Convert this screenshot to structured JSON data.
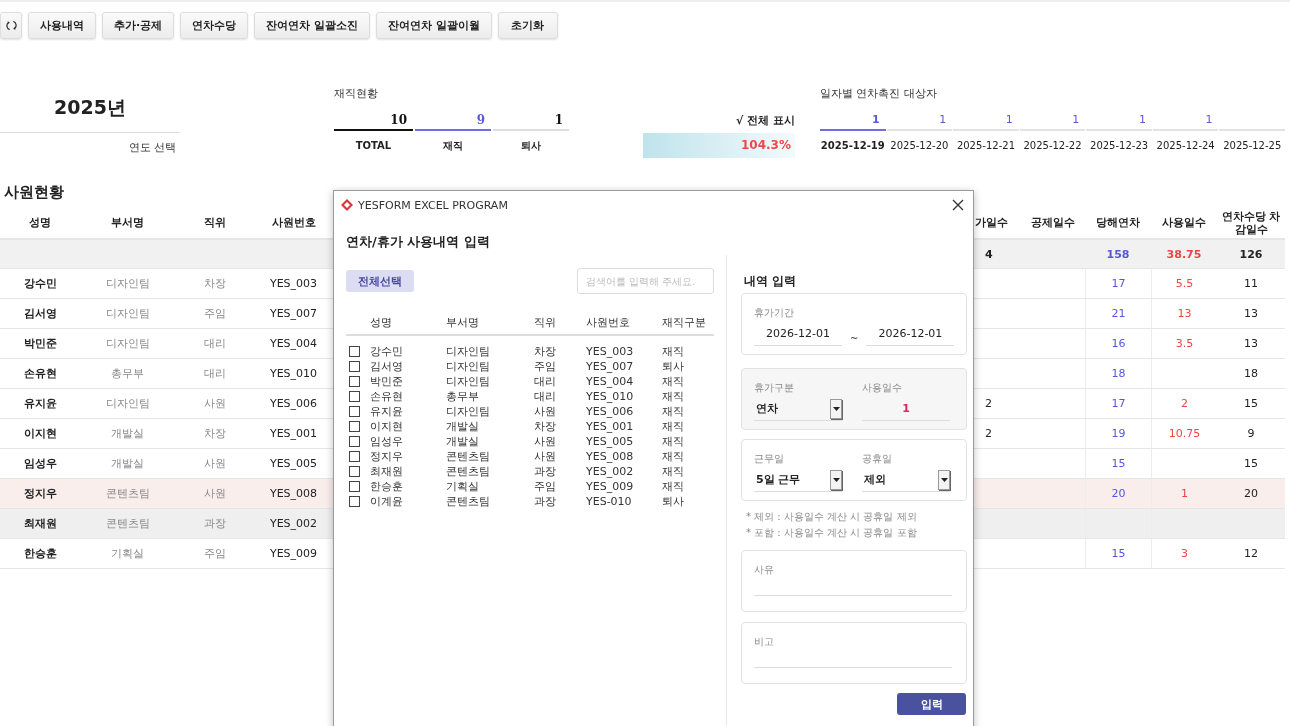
{
  "toolbar": {
    "buttons": [
      {
        "kind": "refresh"
      },
      {
        "kind": "text",
        "label": "사용내역"
      },
      {
        "kind": "text",
        "label": "추가·공제"
      },
      {
        "kind": "text",
        "label": "연차수당"
      },
      {
        "kind": "text",
        "label": "잔여연차 일괄소진"
      },
      {
        "kind": "text",
        "label": "잔여연차 일괄이월"
      },
      {
        "kind": "text",
        "label": "초기화"
      }
    ]
  },
  "year": {
    "value": "2025년",
    "label": "연도 선택"
  },
  "employment": {
    "title": "재직현황",
    "stats": [
      {
        "kind": "total",
        "value": "10",
        "label": "TOTAL"
      },
      {
        "kind": "active",
        "value": "9",
        "label": "재직"
      },
      {
        "kind": "resigned",
        "value": "1",
        "label": "퇴사"
      }
    ]
  },
  "show_all": {
    "label": "√ 전체 표시",
    "reading": "104.3%",
    "level": 1
  },
  "promotion": {
    "title": "일자별 연차촉진 대상자",
    "dates": [
      {
        "count": "1",
        "date": "2025-12-19",
        "selected": true
      },
      {
        "count": "1",
        "date": "2025-12-20",
        "selected": false
      },
      {
        "count": "1",
        "date": "2025-12-21",
        "selected": false
      },
      {
        "count": "1",
        "date": "2025-12-22",
        "selected": false
      },
      {
        "count": "1",
        "date": "2025-12-23",
        "selected": false
      },
      {
        "count": "1",
        "date": "2025-12-24",
        "selected": false
      },
      {
        "date": "2025-12-25",
        "selected": false
      }
    ]
  },
  "employees": {
    "title": "사원현황",
    "columns": [
      "성명",
      "부서명",
      "직위",
      "사원번호"
    ],
    "right_columns": [
      "가일수",
      "공제일수",
      "당해연차",
      "사용일수",
      "연차수당 차감일수"
    ],
    "total": {
      "added": "4",
      "annual": "158",
      "used": "38.75",
      "allowance_deduction": "126"
    },
    "rows": [
      {
        "name": "강수민",
        "dept": "디자인팀",
        "position": "차장",
        "id": "YES_003",
        "annual": "17",
        "used": "5.5",
        "allowance_deduction": "11",
        "selected": false,
        "hovered": false
      },
      {
        "name": "김서영",
        "dept": "디자인팀",
        "position": "주임",
        "id": "YES_007",
        "annual": "21",
        "used": "13",
        "allowance_deduction": "13",
        "selected": false,
        "hovered": false
      },
      {
        "name": "박민준",
        "dept": "디자인팀",
        "position": "대리",
        "id": "YES_004",
        "annual": "16",
        "used": "3.5",
        "allowance_deduction": "13",
        "selected": false,
        "hovered": false
      },
      {
        "name": "손유현",
        "dept": "총무부",
        "position": "대리",
        "id": "YES_010",
        "annual": "18",
        "allowance_deduction": "18",
        "selected": false,
        "hovered": false
      },
      {
        "name": "유지윤",
        "dept": "디자인팀",
        "position": "사원",
        "id": "YES_006",
        "added": "2",
        "annual": "17",
        "used": "2",
        "allowance_deduction": "15",
        "selected": false,
        "hovered": false
      },
      {
        "name": "이지현",
        "dept": "개발실",
        "position": "차장",
        "id": "YES_001",
        "added": "2",
        "annual": "19",
        "used": "10.75",
        "allowance_deduction": "9",
        "selected": false,
        "hovered": false
      },
      {
        "name": "임성우",
        "dept": "개발실",
        "position": "사원",
        "id": "YES_005",
        "annual": "15",
        "allowance_deduction": "15",
        "selected": false,
        "hovered": false
      },
      {
        "name": "정지우",
        "dept": "콘텐츠팀",
        "position": "사원",
        "id": "YES_008",
        "annual": "20",
        "used": "1",
        "allowance_deduction": "20",
        "selected": false,
        "hovered": true
      },
      {
        "name": "최재원",
        "dept": "콘텐츠팀",
        "position": "과장",
        "id": "YES_002",
        "selected": true,
        "hovered": false
      },
      {
        "name": "한승훈",
        "dept": "기획실",
        "position": "주임",
        "id": "YES_009",
        "annual": "15",
        "used": "3",
        "allowance_deduction": "12",
        "selected": false,
        "hovered": false
      }
    ]
  },
  "dialog": {
    "app_title": "YESFORM EXCEL PROGRAM",
    "heading": "연차/휴가 사용내역 입력",
    "select_all": "전체선택",
    "search": {
      "placeholder": "검색어를 입력해 주세요."
    },
    "columns": [
      "성명",
      "부서명",
      "직위",
      "사원번호",
      "재직구분"
    ],
    "rows": [
      {
        "cells": [
          "강수민",
          "디자인팀",
          "차장",
          "YES_003",
          "재직"
        ],
        "checked": false
      },
      {
        "cells": [
          "김서영",
          "디자인팀",
          "주임",
          "YES_007",
          "퇴사"
        ],
        "checked": false
      },
      {
        "cells": [
          "박민준",
          "디자인팀",
          "대리",
          "YES_004",
          "재직"
        ],
        "checked": false
      },
      {
        "cells": [
          "손유현",
          "총무부",
          "대리",
          "YES_010",
          "재직"
        ],
        "checked": false
      },
      {
        "cells": [
          "유지윤",
          "디자인팀",
          "사원",
          "YES_006",
          "재직"
        ],
        "checked": false
      },
      {
        "cells": [
          "이지현",
          "개발실",
          "차장",
          "YES_001",
          "재직"
        ],
        "checked": false
      },
      {
        "cells": [
          "임성우",
          "개발실",
          "사원",
          "YES_005",
          "재직"
        ],
        "checked": false
      },
      {
        "cells": [
          "정지우",
          "콘텐츠팀",
          "사원",
          "YES_008",
          "재직"
        ],
        "checked": false
      },
      {
        "cells": [
          "최재원",
          "콘텐츠팀",
          "과장",
          "YES_002",
          "재직"
        ],
        "checked": false
      },
      {
        "cells": [
          "한승훈",
          "기획실",
          "주임",
          "YES_009",
          "재직"
        ],
        "checked": false
      },
      {
        "cells": [
          "이계윤",
          "콘텐츠팀",
          "과장",
          "YES-010",
          "퇴사"
        ],
        "checked": false
      }
    ],
    "form": {
      "title": "내역 입력",
      "period": {
        "label": "휴가기간",
        "from": "2026-12-01",
        "separator": "~",
        "to": "2026-12-01"
      },
      "leave_type": {
        "label": "휴가구분",
        "value": "연차"
      },
      "days": {
        "label": "사용일수",
        "value": "1"
      },
      "workdays": {
        "label": "근무일",
        "value": "5일 근무"
      },
      "holidays": {
        "label": "공휴일",
        "value": "제외"
      },
      "notes": [
        "* 제외 : 사용일수 계산 시 공휴일 제외",
        "* 포함 : 사용일수 계산 시 공휴일 포함"
      ],
      "reason": {
        "label": "사유"
      },
      "remark": {
        "label": "비고"
      },
      "submit": "입력"
    }
  }
}
